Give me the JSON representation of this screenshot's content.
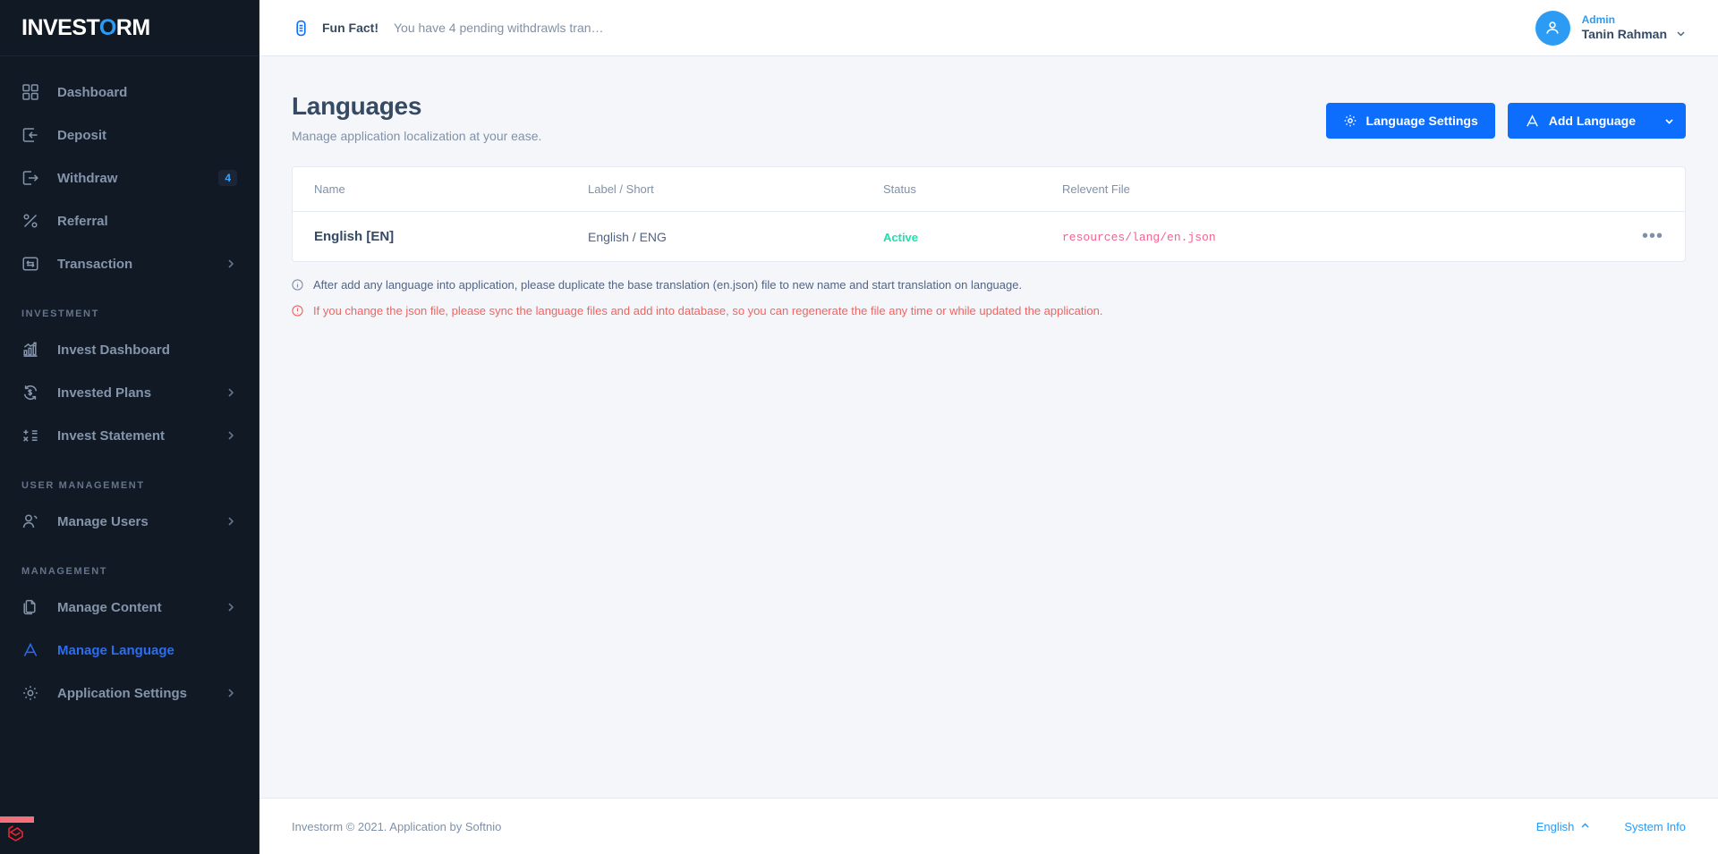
{
  "brand": {
    "name_part1": "INVEST",
    "name_o": "O",
    "name_part2": "RM"
  },
  "sidebar": {
    "items": [
      {
        "label": "Dashboard",
        "icon": "grid-icon",
        "badge": null,
        "chevron": false,
        "active": false
      },
      {
        "label": "Deposit",
        "icon": "deposit-icon",
        "badge": null,
        "chevron": false,
        "active": false
      },
      {
        "label": "Withdraw",
        "icon": "withdraw-icon",
        "badge": "4",
        "chevron": false,
        "active": false
      },
      {
        "label": "Referral",
        "icon": "percent-icon",
        "badge": null,
        "chevron": false,
        "active": false
      },
      {
        "label": "Transaction",
        "icon": "exchange-icon",
        "badge": null,
        "chevron": true,
        "active": false
      }
    ],
    "section_investment": "INVESTMENT",
    "investment_items": [
      {
        "label": "Invest Dashboard",
        "icon": "bar-chart-icon",
        "chevron": false,
        "active": false
      },
      {
        "label": "Invested Plans",
        "icon": "refresh-dollar-icon",
        "chevron": true,
        "active": false
      },
      {
        "label": "Invest Statement",
        "icon": "math-icon",
        "chevron": true,
        "active": false
      }
    ],
    "section_user_management": "USER MANAGEMENT",
    "user_items": [
      {
        "label": "Manage Users",
        "icon": "users-icon",
        "chevron": true,
        "active": false
      }
    ],
    "section_management": "MANAGEMENT",
    "management_items": [
      {
        "label": "Manage Content",
        "icon": "files-icon",
        "chevron": true,
        "active": false
      },
      {
        "label": "Manage Language",
        "icon": "letter-a-icon",
        "chevron": false,
        "active": true
      },
      {
        "label": "Application Settings",
        "icon": "gear-icon",
        "chevron": true,
        "active": false
      }
    ]
  },
  "topbar": {
    "funfact_label": "Fun Fact!",
    "funfact_message": "You have 4 pending withdrawls tran…",
    "user_role": "Admin",
    "user_name": "Tanin Rahman"
  },
  "page": {
    "title": "Languages",
    "subtitle": "Manage application localization at your ease.",
    "btn_settings": "Language Settings",
    "btn_add": "Add Language"
  },
  "table": {
    "columns": [
      "Name",
      "Label / Short",
      "Status",
      "Relevent File"
    ],
    "rows": [
      {
        "name": "English [EN]",
        "label": "English / ENG",
        "status": "Active",
        "file": "resources/lang/en.json"
      }
    ]
  },
  "notes": {
    "info": "After add any language into application, please duplicate the base translation (en.json) file to new name and start translation on language.",
    "warn": "If you change the json file, please sync the language files and add into database, so you can regenerate the file any time or while updated the application."
  },
  "footer": {
    "copyright": "Investorm © 2021. Application by Softnio",
    "language": "English",
    "system_info": "System Info"
  },
  "colors": {
    "accent": "#0d6efd",
    "sidebar_bg": "#101924",
    "status_active": "#1ee0ac",
    "file_path": "#f2638f",
    "warn": "#f2635f"
  }
}
